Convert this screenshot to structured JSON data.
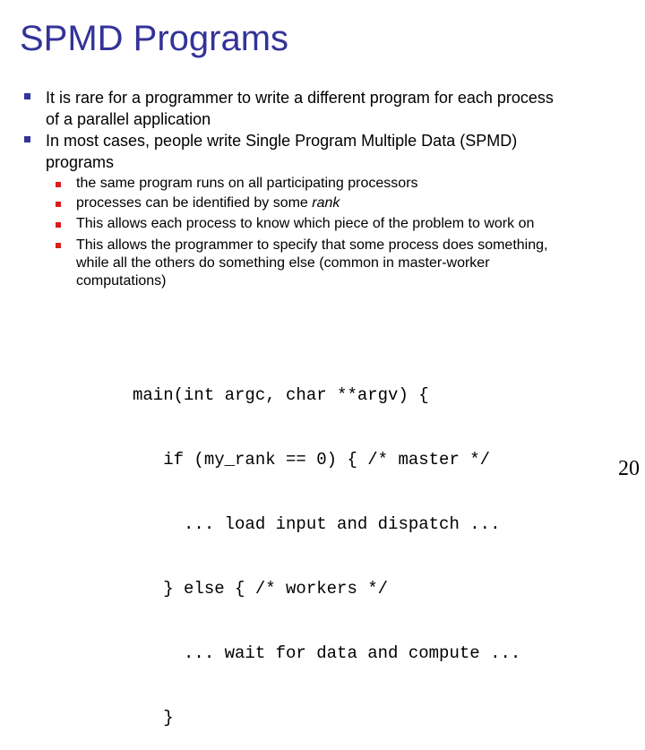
{
  "slide": {
    "title": "SPMD Programs",
    "title_color": "#333399",
    "bullets": [
      {
        "icon": "square-bullet",
        "lines": [
          "It is rare for a programmer to write a different program for each process",
          "of a parallel application"
        ]
      },
      {
        "icon": "square-bullet",
        "lines": [
          "In most cases, people write Single Program Multiple Data (SPMD)",
          "programs"
        ],
        "sub_bullets": [
          {
            "icon": "square-bullet",
            "text": "the same program runs on all participating processors"
          },
          {
            "icon": "square-bullet",
            "text_before": "processes can be identified by some ",
            "text_italic": "rank"
          },
          {
            "icon": "square-bullet",
            "text": "This allows each process to know which piece of the problem to work on"
          },
          {
            "icon": "square-bullet",
            "lines": [
              "This allows the programmer to specify that some process does something,",
              "while all the others do something else (common in master-worker",
              "computations)"
            ]
          }
        ]
      }
    ],
    "code_lines": [
      "main(int argc, char **argv) {",
      "   if (my_rank == 0) { /* master */",
      "     ... load input and dispatch ...",
      "   } else { /* workers */",
      "     ... wait for data and compute ...",
      "   }"
    ],
    "page_number": "20",
    "colors": {
      "primary_bullet": "#333399",
      "secondary_bullet": "#dd1c1c"
    }
  }
}
